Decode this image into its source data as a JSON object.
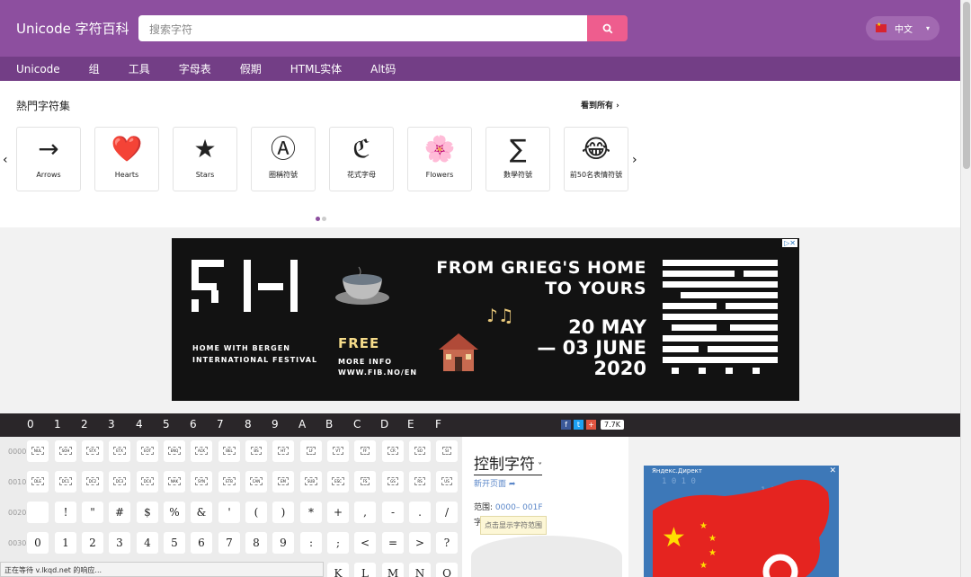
{
  "header": {
    "logo": "Unicode 字符百科",
    "search_placeholder": "搜索字符",
    "language": "中文"
  },
  "nav": [
    "Unicode",
    "组",
    "工具",
    "字母表",
    "假期",
    "HTML实体",
    "Alt码"
  ],
  "popular": {
    "title": "熱門字符集",
    "see_all": "看到所有",
    "cards": [
      {
        "symbol": "→",
        "label": "Arrows"
      },
      {
        "symbol": "❤️",
        "label": "Hearts"
      },
      {
        "symbol": "★",
        "label": "Stars"
      },
      {
        "symbol": "Ⓐ",
        "label": "圈稱符號"
      },
      {
        "symbol": "ℭ",
        "label": "花式字母"
      },
      {
        "symbol": "🌸",
        "label": "Flowers"
      },
      {
        "symbol": "∑",
        "label": "數學符號"
      },
      {
        "symbol": "😂",
        "label": "前50名表情符號"
      }
    ]
  },
  "ad_banner": {
    "tagline": "HOME WITH BERGEN INTERNATIONAL FESTIVAL",
    "free": "FREE",
    "more_info": "MORE INFO WWW.FIB.NO/EN",
    "headline_1": "FROM GRIEG'S HOME",
    "headline_2": "TO YOURS",
    "date_1": "20 MAY",
    "date_2": "— 03 JUNE",
    "date_3": "2020"
  },
  "char_table": {
    "hex_columns": [
      "0",
      "1",
      "2",
      "3",
      "4",
      "5",
      "6",
      "7",
      "8",
      "9",
      "A",
      "B",
      "C",
      "D",
      "E",
      "F"
    ],
    "share_count": "7.7K",
    "rows": [
      {
        "label": "0000",
        "type": "control",
        "cells": [
          "NUL",
          "SOH",
          "STX",
          "ETX",
          "EOT",
          "ENQ",
          "ACK",
          "BEL",
          "BS",
          "HT",
          "LF",
          "VT",
          "FF",
          "CR",
          "SO",
          "SI"
        ]
      },
      {
        "label": "0010",
        "type": "control",
        "cells": [
          "DLE",
          "DC1",
          "DC2",
          "DC3",
          "DC4",
          "NAK",
          "SYN",
          "ETB",
          "CAN",
          "EM",
          "SUB",
          "ESC",
          "FS",
          "GS",
          "RS",
          "US"
        ]
      },
      {
        "label": "0020",
        "type": "char",
        "cells": [
          " ",
          "!",
          "\"",
          "#",
          "$",
          "%",
          "&",
          "'",
          "(",
          ")",
          "*",
          "+",
          ",",
          "-",
          ".",
          "/"
        ]
      },
      {
        "label": "0030",
        "type": "char",
        "cells": [
          "0",
          "1",
          "2",
          "3",
          "4",
          "5",
          "6",
          "7",
          "8",
          "9",
          ":",
          ";",
          "<",
          "=",
          ">",
          "?"
        ]
      }
    ],
    "partial_row": [
      "K",
      "L",
      "M",
      "N",
      "O"
    ]
  },
  "info_panel": {
    "title": "控制字符",
    "new_page": "新开页面",
    "range_label": "范围:",
    "range_value": "0000– 001F",
    "char_prefix": "字",
    "tooltip": "点击显示字符范围"
  },
  "side_ad": {
    "label": "Яндекс.Директ"
  },
  "status": "正在等待 v.lkqd.net 的响应..."
}
